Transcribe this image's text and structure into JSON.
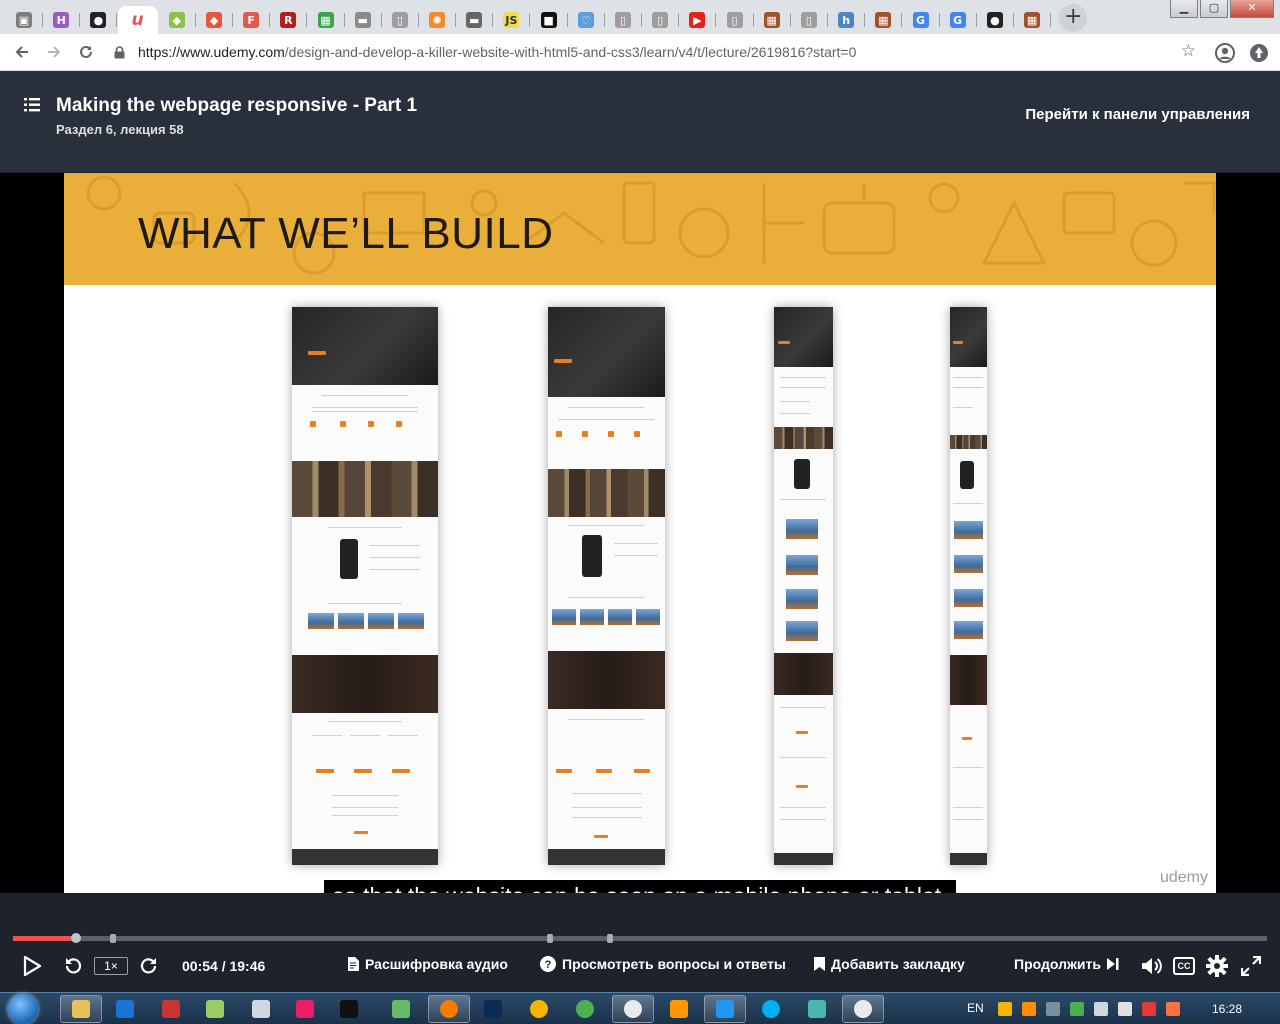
{
  "browser": {
    "tabs": [
      {
        "icon": "tab-generic-icon",
        "color": "#7d7d7d",
        "glyph": "▣",
        "active": false
      },
      {
        "icon": "tab-h-icon",
        "color": "#9b5bc4",
        "glyph": "H",
        "active": false
      },
      {
        "icon": "github-icon",
        "color": "#222222",
        "glyph": "●",
        "active": false
      },
      {
        "icon": "udemy-icon",
        "color": "#ffffff",
        "glyph": "u",
        "active": true
      },
      {
        "icon": "android-green-icon",
        "color": "#8bc34a",
        "glyph": "◆",
        "active": false
      },
      {
        "icon": "git-icon",
        "color": "#e8563f",
        "glyph": "◆",
        "active": false
      },
      {
        "icon": "f-icon",
        "color": "#e05a4e",
        "glyph": "F",
        "active": false
      },
      {
        "icon": "r-icon",
        "color": "#b1201e",
        "glyph": "R",
        "active": false
      },
      {
        "icon": "grid-color-icon",
        "color": "#3fa34d",
        "glyph": "▦",
        "active": false
      },
      {
        "icon": "keyboard-icon",
        "color": "#8a8a8a",
        "glyph": "▬",
        "active": false
      },
      {
        "icon": "document-icon",
        "color": "#9e9e9e",
        "glyph": "▯",
        "active": false
      },
      {
        "icon": "wheel-icon",
        "color": "#f08a2b",
        "glyph": "✺",
        "active": false
      },
      {
        "icon": "bar-icon",
        "color": "#666666",
        "glyph": "▬",
        "active": false
      },
      {
        "icon": "js-icon",
        "color": "#f0db4f",
        "glyph": "JS",
        "active": false
      },
      {
        "icon": "black-square-icon",
        "color": "#111111",
        "glyph": "■",
        "active": false
      },
      {
        "icon": "heart-icon",
        "color": "#5aa0e0",
        "glyph": "♡",
        "active": false
      },
      {
        "icon": "document-icon",
        "color": "#9e9e9e",
        "glyph": "▯",
        "active": false
      },
      {
        "icon": "document-icon",
        "color": "#9e9e9e",
        "glyph": "▯",
        "active": false
      },
      {
        "icon": "youtube-icon",
        "color": "#e62117",
        "glyph": "▶",
        "active": false
      },
      {
        "icon": "document-icon",
        "color": "#9e9e9e",
        "glyph": "▯",
        "active": false
      },
      {
        "icon": "tiles-icon",
        "color": "#a0522d",
        "glyph": "▦",
        "active": false
      },
      {
        "icon": "document-icon",
        "color": "#9e9e9e",
        "glyph": "▯",
        "active": false
      },
      {
        "icon": "h-blue-icon",
        "color": "#4a86c8",
        "glyph": "h",
        "active": false
      },
      {
        "icon": "tiles-icon",
        "color": "#a0522d",
        "glyph": "▦",
        "active": false
      },
      {
        "icon": "google-icon",
        "color": "#4285f4",
        "glyph": "G",
        "active": false
      },
      {
        "icon": "google-icon",
        "color": "#4285f4",
        "glyph": "G",
        "active": false
      },
      {
        "icon": "github-icon",
        "color": "#222222",
        "glyph": "●",
        "active": false
      },
      {
        "icon": "tiles-icon",
        "color": "#a0522d",
        "glyph": "▦",
        "active": false
      }
    ],
    "new_tab_label": "+",
    "url_host": "https://www.udemy.com",
    "url_path": "/design-and-develop-a-killer-website-with-html5-and-css3/learn/v4/t/lecture/2619816?start=0"
  },
  "header": {
    "title": "Making the webpage responsive - Part 1",
    "subtitle": "Раздел 6, лекция 58",
    "dashboard_link": "Перейти к панели управления"
  },
  "video": {
    "slide_title": "WHAT WE’LL BUILD",
    "watermark": "udemy",
    "subtitle": "so that the website can be seen on a mobile phone or tablet.",
    "banner_color": "#eaae3b",
    "progress": {
      "position_fraction": 0.0463
    },
    "chapter_markers": [
      0.08,
      0.428,
      0.476
    ]
  },
  "controls": {
    "rate": "1×",
    "time": "00:54 / 19:46",
    "transcript": "Расшифровка аудио",
    "qa": "Просмотреть вопросы и ответы",
    "bookmark": "Добавить закладку",
    "continue": "Продолжить",
    "cc": "CC",
    "accent_color": "#ec5252"
  },
  "taskbar": {
    "apps": [
      {
        "icon": "explorer-icon",
        "color": "#e8c15a",
        "open": true
      },
      {
        "icon": "teamviewer-icon",
        "color": "#1a74d4",
        "open": false
      },
      {
        "icon": "save-icon",
        "color": "#cc3333",
        "open": false
      },
      {
        "icon": "android-icon",
        "color": "#9ccc65",
        "open": false
      },
      {
        "icon": "box-icon",
        "color": "#cfd8dc",
        "open": false
      },
      {
        "icon": "link-icon",
        "color": "#e91e63",
        "open": false
      },
      {
        "icon": "intellij-icon",
        "color": "#111111",
        "open": false
      },
      {
        "icon": "leaf-icon",
        "color": "#66bb6a",
        "open": false
      },
      {
        "icon": "firefox-icon",
        "color": "#f57c00",
        "open": true
      },
      {
        "icon": "photoshop-icon",
        "color": "#0a2b53",
        "open": false
      },
      {
        "icon": "chrome-color-icon",
        "color": "#f4b400",
        "open": false
      },
      {
        "icon": "atom-icon",
        "color": "#4caf50",
        "open": false
      },
      {
        "icon": "chrome-icon",
        "color": "#e8eaed",
        "open": true
      },
      {
        "icon": "sublime-icon",
        "color": "#ff9800",
        "open": false
      },
      {
        "icon": "window-icon",
        "color": "#2196f3",
        "open": true
      },
      {
        "icon": "skype-icon",
        "color": "#00aff0",
        "open": false
      },
      {
        "icon": "calculator-icon",
        "color": "#4db6ac",
        "open": false
      },
      {
        "icon": "chrome-icon",
        "color": "#e8eaed",
        "open": true
      }
    ],
    "language": "EN",
    "clock": "16:28"
  }
}
